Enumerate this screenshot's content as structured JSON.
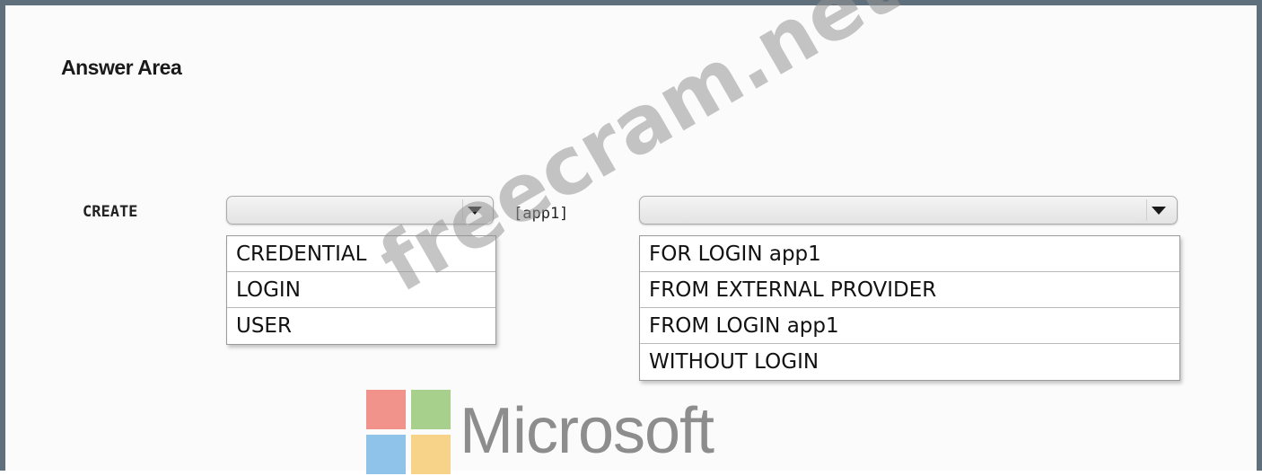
{
  "title": "Answer Area",
  "statement": {
    "prefix": "CREATE",
    "middle": "[app1]"
  },
  "dropdown1": {
    "selected": "",
    "options": [
      "CREDENTIAL",
      "LOGIN",
      "USER"
    ]
  },
  "dropdown2": {
    "selected": "",
    "options": [
      "FOR LOGIN app1",
      "FROM EXTERNAL PROVIDER",
      "FROM LOGIN app1",
      "WITHOUT LOGIN"
    ]
  },
  "logo": {
    "wordmark": "Microsoft",
    "colors": {
      "red": "#f1938a",
      "green": "#a8d08d",
      "blue": "#8fc3e9",
      "yellow": "#f7d38a"
    }
  },
  "watermark": "freecram.net",
  "colors": {
    "frame": "#5f6f7b"
  }
}
